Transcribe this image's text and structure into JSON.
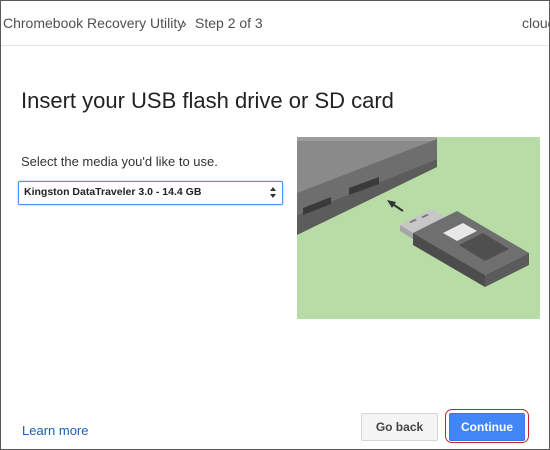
{
  "header": {
    "app_title": "Chromebook Recovery Utility",
    "separator": "›",
    "step": "Step 2 of 3",
    "right_text": "cloud"
  },
  "main": {
    "title": "Insert your USB flash drive or SD card",
    "media_prompt": "Select the media you'd like to use.",
    "media_select_value": "Kingston DataTraveler 3.0 - 14.4 GB"
  },
  "illustration": {
    "icon": "usb-insert-illustration",
    "background_color": "#b7dca6"
  },
  "footer": {
    "learn_more": "Learn more",
    "go_back": "Go back",
    "continue": "Continue"
  },
  "colors": {
    "accent": "#4285f4",
    "link": "#1a5fb4",
    "highlight_ring": "#c62828"
  }
}
